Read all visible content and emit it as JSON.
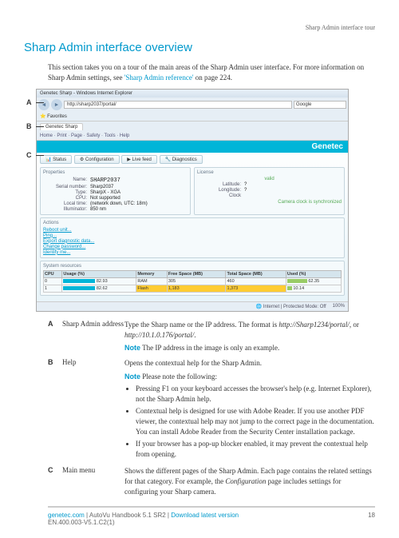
{
  "header": {
    "tour_label": "Sharp Admin interface tour",
    "page_title": "Sharp Admin interface overview"
  },
  "intro": {
    "text_before": "This section takes you on a tour of the main areas of the Sharp Admin user interface. For more information on Sharp Admin settings, see ",
    "link": "'Sharp Admin reference'",
    "text_after": " on page 224."
  },
  "callouts": {
    "a": "A",
    "b": "B",
    "c": "C"
  },
  "browser": {
    "title": "Genetec Sharp - Windows Internet Explorer",
    "address": "http://sharp2037/portal/",
    "search_placeholder": "Google",
    "favorites": "Favorites",
    "tab": "Genetec Sharp",
    "toolbar_items": "Home  ·  Print  ·  Page  ·  Safety  ·  Tools  ·  Help",
    "logo": "Genetec",
    "menu": {
      "status": "Status",
      "config": "Configuration",
      "live": "Live feed",
      "diag": "Diagnostics"
    },
    "props": {
      "header": "Properties",
      "name_k": "Name:",
      "name_v": "SHARP2037",
      "serial_k": "Serial number:",
      "serial_v": "Sharp2037",
      "type_k": "Type:",
      "type_v": "SharpX - XGA",
      "cpu_k": "CPU:",
      "cpu_v": "Not supported",
      "time_k": "Local time:",
      "time_v": "(network down, UTC: 18m)",
      "illum_k": "Illuminator:",
      "illum_v": "850 nm"
    },
    "license": {
      "header": "License",
      "state": "valid",
      "lat_k": "Latitude:",
      "lat_v": "?",
      "lon_k": "Longitude:",
      "lon_v": "?",
      "clock_k": "Clock",
      "sync": "Camera clock is synchronized"
    },
    "actions": {
      "header": "Actions",
      "reboot": "Reboot unit...",
      "ping": "Ping...",
      "export": "Export diagnostic data...",
      "pwd": "Change password...",
      "identify": "Identify me..."
    },
    "resources": {
      "header": "System resources",
      "hdr_cpu": "CPU",
      "hdr_usage": "Usage (%)",
      "hdr_mem": "Memory",
      "hdr_free": "Free Space (MB)",
      "hdr_total": "Total Space (MB)",
      "hdr_used": "Used (%)",
      "r0_cpu": "0",
      "r0_usage": "82.93",
      "r0_mem": "RAM",
      "r0_free": "305",
      "r0_total": "460",
      "r0_used": "62.35",
      "r1_cpu": "1",
      "r1_usage": "82.62",
      "r1_mem": "Flash",
      "r1_free": "1,183",
      "r1_total": "1,373",
      "r1_used": "10.14"
    },
    "status": {
      "zone": "Internet | Protected Mode: Off",
      "zoom": "100%"
    }
  },
  "legend": {
    "a": {
      "letter": "A",
      "term": "Sharp Admin address",
      "desc_before": "Type the Sharp name or the IP address. The format is ",
      "fmt1": "http://Sharp1234/portal/",
      "mid": ", or ",
      "fmt2": "http://10.1.0.176/portal/",
      "end": ".",
      "note_label": "Note",
      "note_text": "  The IP address in the image is only an example."
    },
    "b": {
      "letter": "B",
      "term": "Help",
      "desc": "Opens the contextual help for the Sharp Admin.",
      "note_label": "Note",
      "note_intro": "  Please note the following:",
      "li1": "Pressing F1 on your keyboard accesses the browser's help (e.g. Internet Explorer), not the Sharp Admin help.",
      "li2": "Contextual help is designed for use with Adobe Reader. If you use another PDF viewer, the contextual help may not jump to the correct page in the documentation. You can install Adobe Reader from the Security Center installation package.",
      "li3": "If your browser has a pop-up blocker enabled, it may prevent the contextual help from opening."
    },
    "c": {
      "letter": "C",
      "term": "Main menu",
      "desc_before": "Shows the different pages of the Sharp Admin. Each page contains the related settings for that category. For example, the ",
      "config": "Configuration",
      "desc_after": " page includes settings for configuring your Sharp camera."
    }
  },
  "footer": {
    "site": "genetec.com",
    "mid": " | AutoVu Handbook 5.1 SR2 | ",
    "dl": "Download latest version",
    "doc": "EN.400.003-V5.1.C2(1)",
    "page": "18"
  }
}
